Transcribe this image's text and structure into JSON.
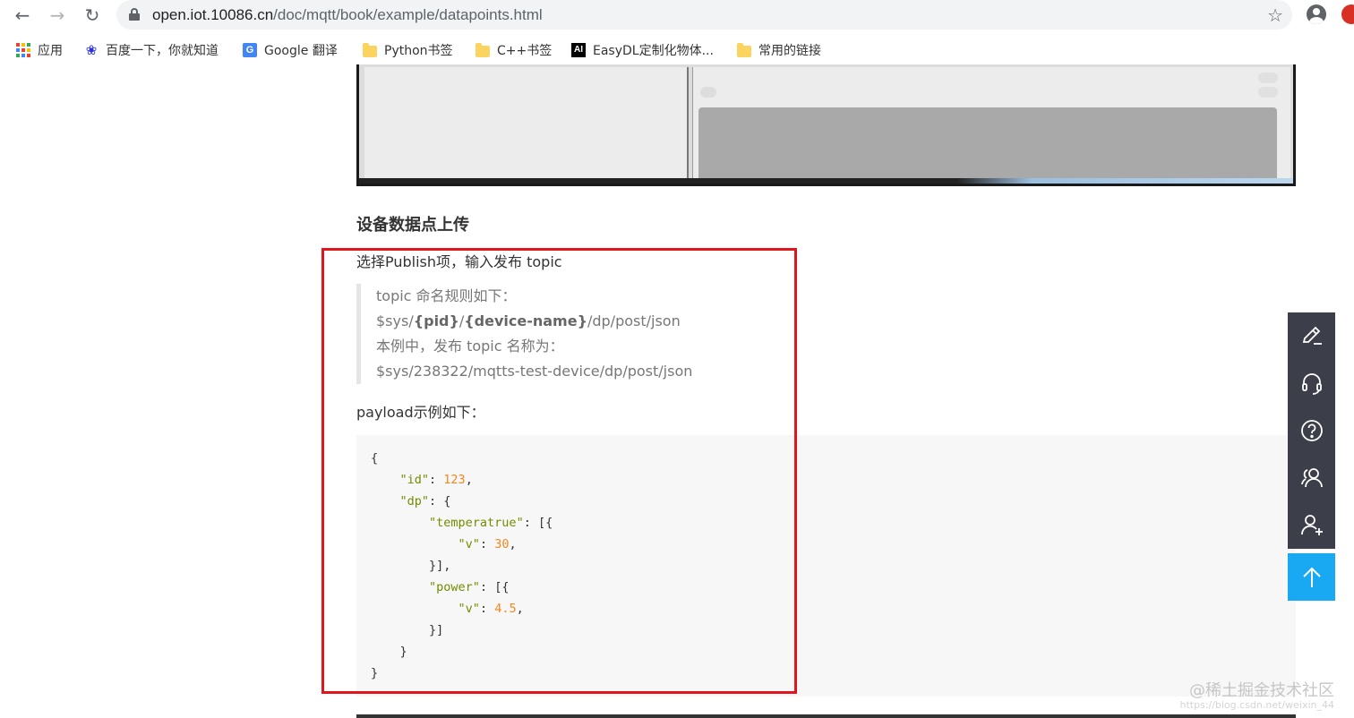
{
  "browser": {
    "url_host": "open.iot.10086.cn",
    "url_path": "/doc/mqtt/book/example/datapoints.html",
    "bookmarks": [
      {
        "label": "应用",
        "icon": "apps-grid-icon"
      },
      {
        "label": "百度一下，你就知道",
        "icon": "baidu-paw-icon"
      },
      {
        "label": "Google 翻译",
        "icon": "google-translate-icon"
      },
      {
        "label": "Python书签",
        "icon": "folder-icon"
      },
      {
        "label": "C++书签",
        "icon": "folder-icon"
      },
      {
        "label": "EasyDL定制化物体...",
        "icon": "ai-logo-icon"
      },
      {
        "label": "常用的链接",
        "icon": "folder-icon"
      }
    ]
  },
  "article": {
    "section_title": "设备数据点上传",
    "intro": "选择Publish项，输入发布 topic",
    "quote": {
      "line1": "topic 命名规则如下：",
      "line2_prefix": "$sys/",
      "line2_pid": "{pid}",
      "line2_sep": "/",
      "line2_device": "{device-name}",
      "line2_suffix": "/dp/post/json",
      "line3": "本例中，发布 topic 名称为：",
      "line4": "$sys/238322/mqtts-test-device/dp/post/json"
    },
    "payload_label": "payload示例如下：",
    "code": {
      "l1": "{",
      "id_key": "\"id\"",
      "id_val": "123",
      "dp_key": "\"dp\"",
      "temp_key": "\"temperatrue\"",
      "v_key": "\"v\"",
      "temp_val": "30",
      "power_key": "\"power\"",
      "power_val": "4.5"
    }
  },
  "watermark": {
    "text": "@稀土掘金技术社区",
    "url": "https://blog.csdn.net/weixin_44"
  },
  "colors": {
    "highlight": "#e0161c",
    "sidebar_bg": "#3c3f4a",
    "back_to_top": "#19a9f2",
    "code_key": "#718c00",
    "code_number": "#f5871f"
  }
}
